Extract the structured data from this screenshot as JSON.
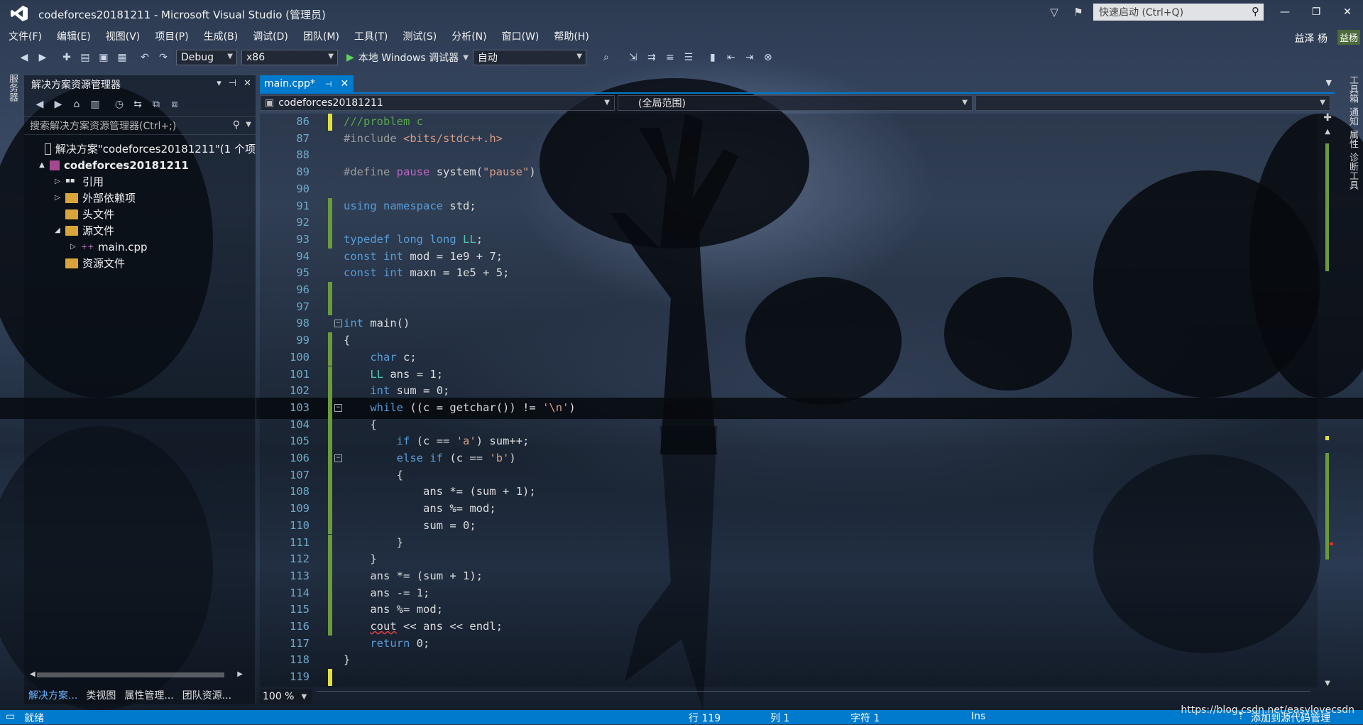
{
  "window": {
    "title": "codeforces20181211 - Microsoft Visual Studio (管理员)",
    "quick_launch_placeholder": "快速启动 (Ctrl+Q)",
    "user": "益泽 杨",
    "user_badge": "益杨"
  },
  "menu": [
    "文件(F)",
    "编辑(E)",
    "视图(V)",
    "项目(P)",
    "生成(B)",
    "调试(D)",
    "团队(M)",
    "工具(T)",
    "测试(S)",
    "分析(N)",
    "窗口(W)",
    "帮助(H)"
  ],
  "toolbar": {
    "config": "Debug",
    "platform": "x86",
    "debugger": "本地 Windows 调试器",
    "auto": "自动"
  },
  "left_strip": {
    "label": "服务器"
  },
  "solution_explorer": {
    "title": "解决方案资源管理器",
    "search_placeholder": "搜索解决方案资源管理器(Ctrl+;)",
    "items": [
      {
        "label": "解决方案\"codeforces20181211\"(1 个项",
        "level": 0,
        "expand": "",
        "icon": "solution-icon"
      },
      {
        "label": "codeforces20181211",
        "level": 0,
        "expand": "▲",
        "icon": "project-icon"
      },
      {
        "label": "引用",
        "level": 1,
        "expand": "▷",
        "icon": "references-icon"
      },
      {
        "label": "外部依赖项",
        "level": 1,
        "expand": "▷",
        "icon": "dependencies-icon"
      },
      {
        "label": "头文件",
        "level": 1,
        "expand": "",
        "icon": "folder-icon"
      },
      {
        "label": "源文件",
        "level": 1,
        "expand": "◢",
        "icon": "folder-icon"
      },
      {
        "label": "main.cpp",
        "level": 2,
        "expand": "▷",
        "icon": "cpp-file-icon"
      },
      {
        "label": "资源文件",
        "level": 1,
        "expand": "",
        "icon": "folder-icon"
      }
    ],
    "bottom_tabs": [
      "解决方案...",
      "类视图",
      "属性管理...",
      "团队资源..."
    ]
  },
  "editor": {
    "tab_label": "main.cpp*",
    "nav_project": "codeforces20181211",
    "nav_scope": "(全局范围)",
    "zoom": "100 %",
    "lines": [
      {
        "n": "86",
        "text": "///problem c",
        "chg": "yellow"
      },
      {
        "n": "87",
        "text": "#include <bits/stdc++.h>",
        "chg": ""
      },
      {
        "n": "88",
        "text": "",
        "chg": ""
      },
      {
        "n": "89",
        "text": "#define pause system(\"pause\")",
        "chg": ""
      },
      {
        "n": "90",
        "text": "",
        "chg": ""
      },
      {
        "n": "91",
        "text": "using namespace std;",
        "chg": "green"
      },
      {
        "n": "92",
        "text": "",
        "chg": "green"
      },
      {
        "n": "93",
        "text": "typedef long long LL;",
        "chg": "green"
      },
      {
        "n": "94",
        "text": "const int mod = 1e9 + 7;",
        "chg": ""
      },
      {
        "n": "95",
        "text": "const int maxn = 1e5 + 5;",
        "chg": ""
      },
      {
        "n": "96",
        "text": "",
        "chg": "green"
      },
      {
        "n": "97",
        "text": "",
        "chg": "green"
      },
      {
        "n": "98",
        "text": "int main()",
        "chg": "",
        "fold": "−"
      },
      {
        "n": "99",
        "text": "{",
        "chg": "green"
      },
      {
        "n": "100",
        "text": "    char c;",
        "chg": "green"
      },
      {
        "n": "101",
        "text": "    LL ans = 1;",
        "chg": "green"
      },
      {
        "n": "102",
        "text": "    int sum = 0;",
        "chg": "green"
      },
      {
        "n": "103",
        "text": "    while ((c = getchar()) != '\\n')",
        "chg": "green",
        "fold": "−"
      },
      {
        "n": "104",
        "text": "    {",
        "chg": "green"
      },
      {
        "n": "105",
        "text": "        if (c == 'a') sum++;",
        "chg": "green"
      },
      {
        "n": "106",
        "text": "        else if (c == 'b')",
        "chg": "green",
        "fold": "−"
      },
      {
        "n": "107",
        "text": "        {",
        "chg": "green"
      },
      {
        "n": "108",
        "text": "            ans *= (sum + 1);",
        "chg": "green"
      },
      {
        "n": "109",
        "text": "            ans %= mod;",
        "chg": "green"
      },
      {
        "n": "110",
        "text": "            sum = 0;",
        "chg": "green"
      },
      {
        "n": "111",
        "text": "        }",
        "chg": "green"
      },
      {
        "n": "112",
        "text": "    }",
        "chg": "green"
      },
      {
        "n": "113",
        "text": "    ans *= (sum + 1);",
        "chg": "green"
      },
      {
        "n": "114",
        "text": "    ans -= 1;",
        "chg": "green"
      },
      {
        "n": "115",
        "text": "    ans %= mod;",
        "chg": "green"
      },
      {
        "n": "116",
        "text": "    cout << ans << endl;",
        "chg": "green"
      },
      {
        "n": "117",
        "text": "    return 0;",
        "chg": ""
      },
      {
        "n": "118",
        "text": "}",
        "chg": ""
      },
      {
        "n": "119",
        "text": "",
        "chg": "yellow"
      }
    ]
  },
  "right_strip": [
    "工具箱",
    "通知",
    "属性",
    "诊断工具"
  ],
  "status": {
    "ready": "就绪",
    "line": "行 119",
    "col": "列 1",
    "char": "字符 1",
    "ins": "Ins",
    "add_source": "添加到源代码管理"
  },
  "watermark": "https://blog.csdn.net/easylovecsdn",
  "colors": {
    "accent": "#007acc",
    "keyword": "#569cd6",
    "string": "#d69d85"
  }
}
